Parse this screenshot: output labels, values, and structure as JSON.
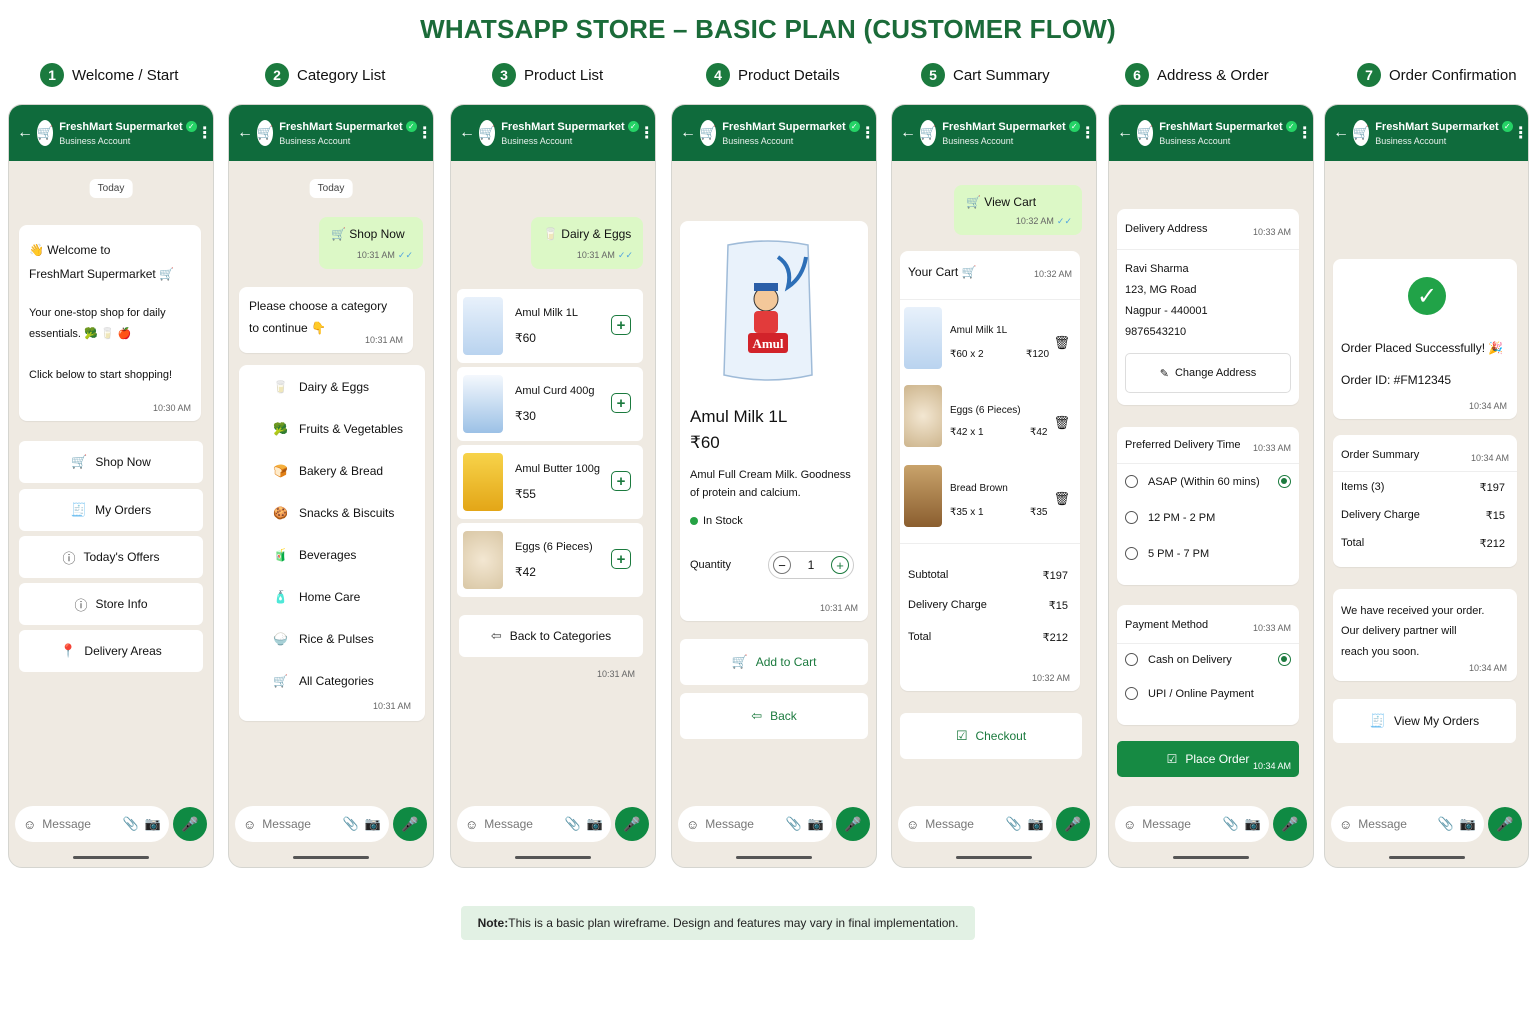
{
  "title": "WHATSAPP STORE – BASIC PLAN (CUSTOMER FLOW)",
  "colors": {
    "brand": "#0f6b3c",
    "accent": "#1b7a3e",
    "chat_bg": "#efeae2",
    "out_bubble": "#dcf8c6"
  },
  "steps": [
    {
      "num": "1",
      "label": "Welcome / Start"
    },
    {
      "num": "2",
      "label": "Category List"
    },
    {
      "num": "3",
      "label": "Product List"
    },
    {
      "num": "4",
      "label": "Product Details"
    },
    {
      "num": "5",
      "label": "Cart Summary"
    },
    {
      "num": "6",
      "label": "Address & Order"
    },
    {
      "num": "7",
      "label": "Order Confirmation"
    }
  ],
  "common": {
    "biz_name": "FreshMart Supermarket",
    "biz_sub": "Business Account",
    "today": "Today",
    "composer_placeholder": "Message"
  },
  "s1": {
    "welcome_line1": "👋 Welcome to",
    "welcome_line2": "FreshMart Supermarket 🛒",
    "body1": "Your one-stop shop for daily",
    "body2": "essentials. 🥦 🥛 🍎",
    "body3": "Click below to start shopping!",
    "time": "10:30 AM",
    "buttons": [
      "Shop Now",
      "My Orders",
      "Today's Offers",
      "Store Info",
      "Delivery Areas"
    ]
  },
  "s2": {
    "shop_now": "Shop Now",
    "time_out": "10:31 AM",
    "prompt1": "Please choose a category",
    "prompt2": "to continue 👇",
    "time_in": "10:31 AM",
    "categories": [
      "Dairy & Eggs",
      "Fruits & Vegetables",
      "Bakery & Bread",
      "Snacks & Biscuits",
      "Beverages",
      "Home Care",
      "Rice & Pulses",
      "All Categories"
    ],
    "time_list": "10:31 AM"
  },
  "s3": {
    "selected": "Dairy & Eggs",
    "time_out": "10:31 AM",
    "products": [
      {
        "name": "Amul Milk 1L",
        "price": "₹60"
      },
      {
        "name": "Amul Curd 400g",
        "price": "₹30"
      },
      {
        "name": "Amul Butter 100g",
        "price": "₹55"
      },
      {
        "name": "Eggs (6 Pieces)",
        "price": "₹42"
      }
    ],
    "back": "Back to Categories",
    "time": "10:31 AM"
  },
  "s4": {
    "brand_on_pack": "Amul",
    "name": "Amul Milk 1L",
    "price": "₹60",
    "desc1": "Amul Full Cream Milk. Goodness",
    "desc2": "of protein and calcium.",
    "stock": "In Stock",
    "qty_label": "Quantity",
    "qty": "1",
    "time": "10:31 AM",
    "add": "Add to Cart",
    "back": "Back"
  },
  "s5": {
    "view_cart": "View Cart",
    "time_out": "10:32 AM",
    "title": "Your Cart",
    "time_title": "10:32 AM",
    "items": [
      {
        "name": "Amul Milk 1L",
        "qty": "₹60 x 2",
        "total": "₹120"
      },
      {
        "name": "Eggs (6 Pieces)",
        "qty": "₹42 x 1",
        "total": "₹42"
      },
      {
        "name": "Bread Brown",
        "qty": "₹35 x 1",
        "total": "₹35"
      }
    ],
    "subtotal_label": "Subtotal",
    "subtotal": "₹197",
    "delivery_label": "Delivery Charge",
    "delivery": "₹15",
    "total_label": "Total",
    "total": "₹212",
    "time_summary": "10:32 AM",
    "checkout": "Checkout"
  },
  "s6": {
    "addr_title": "Delivery Address",
    "addr_time": "10:33 AM",
    "addr_lines": [
      "Ravi Sharma",
      "123, MG Road",
      "Nagpur - 440001",
      "9876543210"
    ],
    "change": "Change Address",
    "slot_title": "Preferred Delivery Time",
    "slot_time": "10:33 AM",
    "slots": [
      "ASAP (Within 60 mins)",
      "12 PM - 2 PM",
      "5 PM - 7 PM"
    ],
    "pay_title": "Payment Method",
    "pay_time": "10:33 AM",
    "payments": [
      "Cash on Delivery",
      "UPI / Online Payment"
    ],
    "place": "Place Order",
    "place_time": "10:34 AM"
  },
  "s7": {
    "placed": "Order Placed Successfully! 🎉",
    "order_id": "Order ID: #FM12345",
    "time1": "10:34 AM",
    "summary_title": "Order Summary",
    "summary_time": "10:34 AM",
    "items_label": "Items (3)",
    "items_val": "₹197",
    "delivery_label": "Delivery Charge",
    "delivery_val": "₹15",
    "total_label": "Total",
    "total_val": "₹212",
    "msg1": "We have received your order.",
    "msg2": "Our delivery partner will",
    "msg3": "reach you soon.",
    "time3": "10:34 AM",
    "view_orders": "View My Orders"
  },
  "note_label": "Note:",
  "note_text": " This is a basic plan wireframe. Design and features may vary in final implementation."
}
